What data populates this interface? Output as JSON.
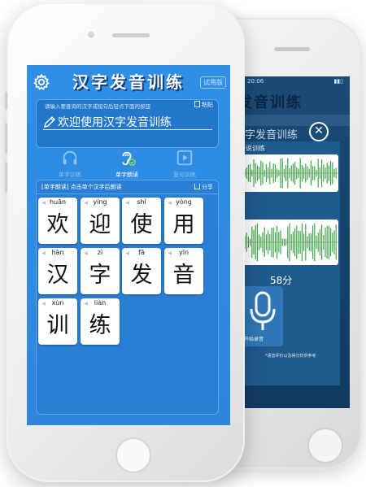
{
  "app": {
    "title": "汉字发音训练",
    "trial_badge": "试用版",
    "input_hint": "请输入要查询的汉字或短句后轻点下面的按钮",
    "paste_label": "粘贴",
    "input_text": "欢迎使用汉字发音训练"
  },
  "modes": [
    {
      "label": "单字训练",
      "icon": "headphones-icon",
      "active": false
    },
    {
      "label": "单字朗读",
      "icon": "ear-icon",
      "active": true
    },
    {
      "label": "复句训练",
      "icon": "play-icon",
      "active": false
    }
  ],
  "lesson": {
    "title": "[单字朗读] 点击单个汉字后朗读",
    "share_label": "分享",
    "cards": [
      {
        "pinyin": "huān",
        "hanzi": "欢"
      },
      {
        "pinyin": "yíng",
        "hanzi": "迎"
      },
      {
        "pinyin": "shǐ",
        "hanzi": "使"
      },
      {
        "pinyin": "yòng",
        "hanzi": "用"
      },
      {
        "pinyin": "hàn",
        "hanzi": "汉"
      },
      {
        "pinyin": "zì",
        "hanzi": "字"
      },
      {
        "pinyin": "fā",
        "hanzi": "发"
      },
      {
        "pinyin": "yīn",
        "hanzi": "音"
      },
      {
        "pinyin": "xùn",
        "hanzi": "训"
      },
      {
        "pinyin": "liàn",
        "hanzi": "练"
      }
    ]
  },
  "back_screen": {
    "time": "20:06",
    "title": "发音训练",
    "headline": "汉字发音训练",
    "subtitle": "听说训练",
    "score": "58分",
    "record_label": "住后开始录音",
    "note": "*语音评价以及得分仅供参考"
  },
  "colors": {
    "screen_blue": "#2f8ee6",
    "title_shadow": "#0d3f7a",
    "waveform_green": "#3fa64a"
  }
}
